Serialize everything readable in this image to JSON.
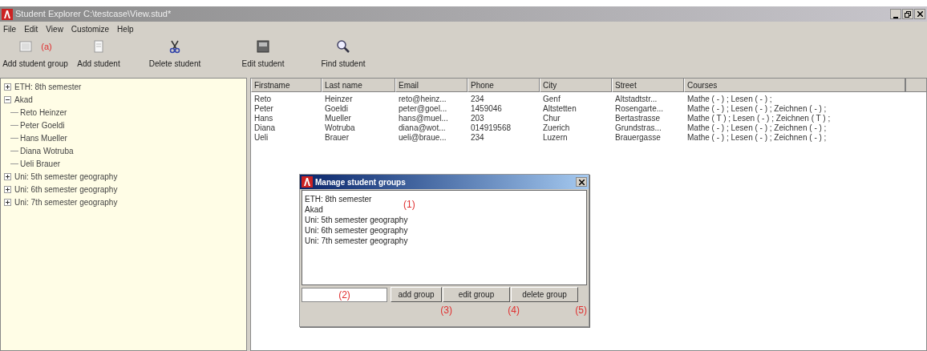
{
  "window": {
    "title": "Student Explorer C:\\testcase\\View.stud*"
  },
  "menu": [
    "File",
    "Edit",
    "View",
    "Customize",
    "Help"
  ],
  "toolbar": [
    {
      "kind": "group",
      "label": "Add student group",
      "annotation": "(a)"
    },
    {
      "kind": "student",
      "label": "Add student"
    },
    {
      "kind": "delete",
      "label": "Delete student"
    },
    {
      "kind": "edit",
      "label": "Edit student"
    },
    {
      "kind": "find",
      "label": "Find student"
    }
  ],
  "tree": [
    {
      "label": "ETH: 8th semester",
      "expanded": false
    },
    {
      "label": "Akad",
      "expanded": true,
      "children": [
        {
          "label": "Reto Heinzer"
        },
        {
          "label": "Peter Goeldi"
        },
        {
          "label": "Hans Mueller"
        },
        {
          "label": "Diana Wotruba"
        },
        {
          "label": "Ueli Brauer"
        }
      ]
    },
    {
      "label": "Uni: 5th semester geography",
      "expanded": false
    },
    {
      "label": "Uni: 6th semester geography",
      "expanded": false
    },
    {
      "label": "Uni: 7th semester geography",
      "expanded": false
    }
  ],
  "table": {
    "columns": [
      "Firstname",
      "Last name",
      "Email",
      "Phone",
      "City",
      "Street",
      "Courses"
    ],
    "rows": [
      [
        "Reto",
        "Heinzer",
        "reto@heinz...",
        "234",
        "Genf",
        "Altstadtstr...",
        "Mathe ( - ) ; Lesen ( - ) ;"
      ],
      [
        "Peter",
        "Goeldi",
        "peter@goel...",
        "1459046",
        "Altstetten",
        "Rosengarte...",
        "Mathe ( - ) ; Lesen ( - ) ; Zeichnen ( - ) ;"
      ],
      [
        "Hans",
        "Mueller",
        "hans@muel...",
        "203",
        "Chur",
        "Bertastrasse",
        "Mathe ( T ) ; Lesen ( - ) ; Zeichnen ( T ) ;"
      ],
      [
        "Diana",
        "Wotruba",
        "diana@wot...",
        "014919568",
        "Zuerich",
        "Grundstras...",
        "Mathe ( - ) ; Lesen ( - ) ; Zeichnen ( - ) ;"
      ],
      [
        "Ueli",
        "Brauer",
        "ueli@braue...",
        "234",
        "Luzern",
        "Brauergasse",
        "Mathe ( - ) ; Lesen ( - ) ; Zeichnen ( - ) ;"
      ]
    ]
  },
  "dialog": {
    "title": "Manage student groups",
    "list_annotation": "(1)",
    "groups": [
      "ETH: 8th semester",
      "Akad",
      "Uni: 5th semester geography",
      "Uni: 6th semester geography",
      "Uni: 7th semester geography"
    ],
    "field_annotation": "(2)",
    "buttons": [
      {
        "label": "add group",
        "annotation": "(3)"
      },
      {
        "label": "edit group",
        "annotation": "(4)"
      },
      {
        "label": "delete group",
        "annotation": "(5)"
      }
    ]
  }
}
